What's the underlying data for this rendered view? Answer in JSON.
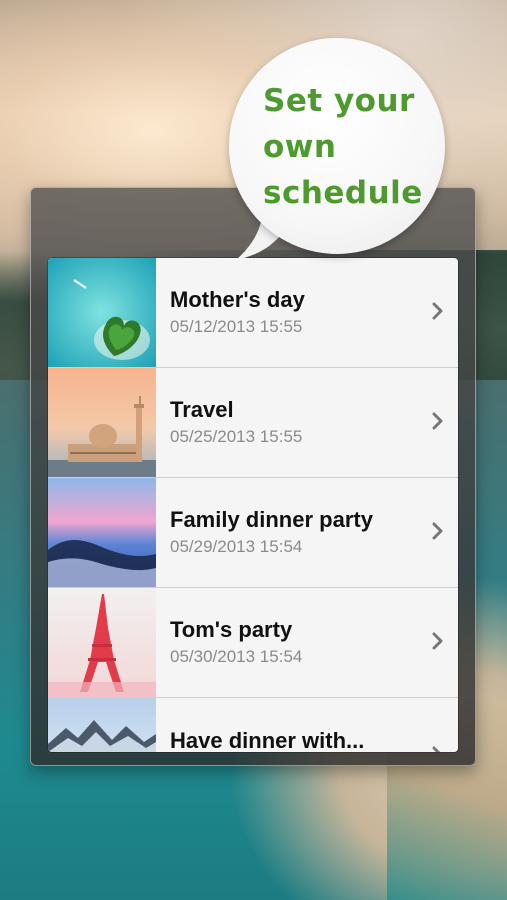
{
  "bubble": {
    "lines": [
      "Set your",
      "own",
      "schedule"
    ],
    "color": "#4f9a2e"
  },
  "events": [
    {
      "title": "Mother's day",
      "date": "05/12/2013 15:55",
      "thumb": "island-thumbnail"
    },
    {
      "title": "Travel",
      "date": "05/25/2013 15:55",
      "thumb": "mosque-thumbnail"
    },
    {
      "title": "Family dinner party",
      "date": "05/29/2013 15:54",
      "thumb": "sea-clouds-thumbnail"
    },
    {
      "title": "Tom's party",
      "date": "05/30/2013 15:54",
      "thumb": "eiffel-tower-thumbnail"
    },
    {
      "title": "Have dinner with...",
      "date": "",
      "thumb": "mountains-thumbnail"
    }
  ],
  "chevron_icon": "chevron-right-icon"
}
